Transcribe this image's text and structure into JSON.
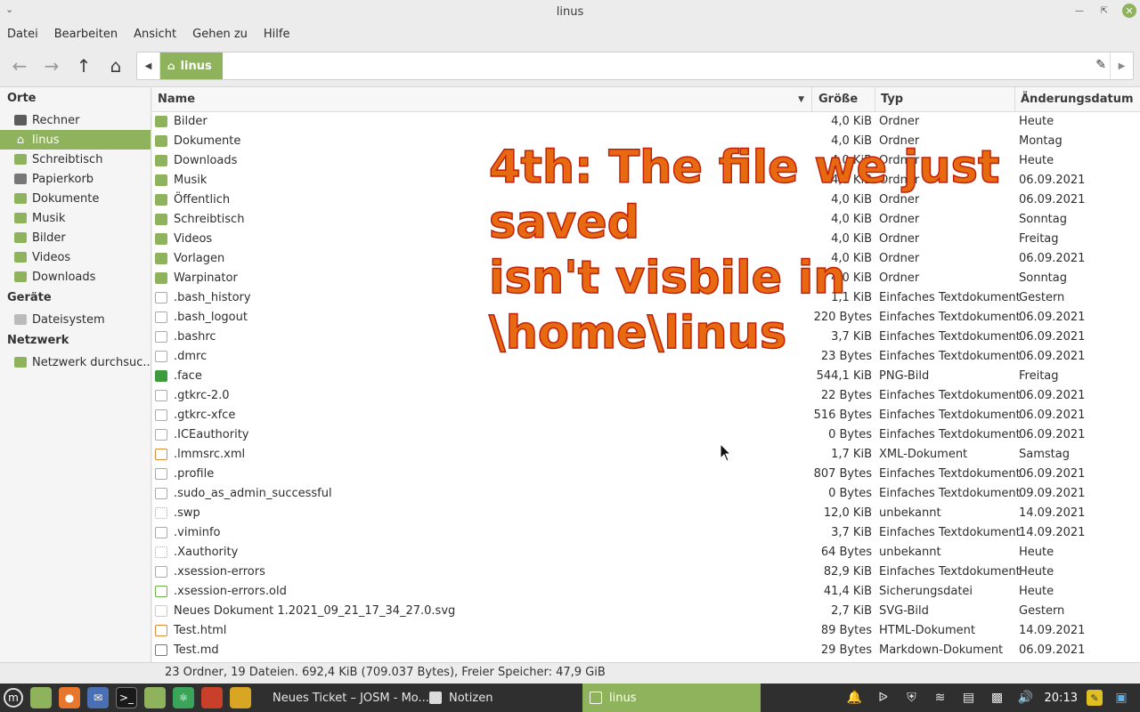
{
  "window": {
    "title": "linus"
  },
  "menu": [
    "Datei",
    "Bearbeiten",
    "Ansicht",
    "Gehen zu",
    "Hilfe"
  ],
  "path": {
    "crumb": "linus"
  },
  "sidebar": {
    "sections": [
      {
        "heading": "Orte",
        "items": [
          {
            "label": "Rechner",
            "icon": "computer-icon"
          },
          {
            "label": "linus",
            "icon": "home-icon",
            "active": true
          },
          {
            "label": "Schreibtisch",
            "icon": "desktop-folder-icon"
          },
          {
            "label": "Papierkorb",
            "icon": "trash-icon"
          },
          {
            "label": "Dokumente",
            "icon": "documents-folder-icon"
          },
          {
            "label": "Musik",
            "icon": "music-folder-icon"
          },
          {
            "label": "Bilder",
            "icon": "pictures-folder-icon"
          },
          {
            "label": "Videos",
            "icon": "videos-folder-icon"
          },
          {
            "label": "Downloads",
            "icon": "downloads-folder-icon"
          }
        ]
      },
      {
        "heading": "Geräte",
        "items": [
          {
            "label": "Dateisystem",
            "icon": "drive-icon"
          }
        ]
      },
      {
        "heading": "Netzwerk",
        "items": [
          {
            "label": "Netzwerk durchsuc...",
            "icon": "network-icon"
          }
        ]
      }
    ]
  },
  "columns": {
    "name": "Name",
    "size": "Größe",
    "type": "Typ",
    "date": "Änderungsdatum"
  },
  "files": [
    {
      "name": "Bilder",
      "size": "4,0 KiB",
      "type": "Ordner",
      "date": "Heute",
      "icon": "folder"
    },
    {
      "name": "Dokumente",
      "size": "4,0 KiB",
      "type": "Ordner",
      "date": "Montag",
      "icon": "folder"
    },
    {
      "name": "Downloads",
      "size": "4,0 KiB",
      "type": "Ordner",
      "date": "Heute",
      "icon": "folder"
    },
    {
      "name": "Musik",
      "size": "4,0 KiB",
      "type": "Ordner",
      "date": "06.09.2021",
      "icon": "folder"
    },
    {
      "name": "Öffentlich",
      "size": "4,0 KiB",
      "type": "Ordner",
      "date": "06.09.2021",
      "icon": "folder"
    },
    {
      "name": "Schreibtisch",
      "size": "4,0 KiB",
      "type": "Ordner",
      "date": "Sonntag",
      "icon": "folder"
    },
    {
      "name": "Videos",
      "size": "4,0 KiB",
      "type": "Ordner",
      "date": "Freitag",
      "icon": "folder"
    },
    {
      "name": "Vorlagen",
      "size": "4,0 KiB",
      "type": "Ordner",
      "date": "06.09.2021",
      "icon": "folder"
    },
    {
      "name": "Warpinator",
      "size": "4,0 KiB",
      "type": "Ordner",
      "date": "Sonntag",
      "icon": "folder"
    },
    {
      "name": ".bash_history",
      "size": "1,1 KiB",
      "type": "Einfaches Textdokument",
      "date": "Gestern",
      "icon": "doc"
    },
    {
      "name": ".bash_logout",
      "size": "220 Bytes",
      "type": "Einfaches Textdokument",
      "date": "06.09.2021",
      "icon": "doc"
    },
    {
      "name": ".bashrc",
      "size": "3,7 KiB",
      "type": "Einfaches Textdokument",
      "date": "06.09.2021",
      "icon": "doc"
    },
    {
      "name": ".dmrc",
      "size": "23 Bytes",
      "type": "Einfaches Textdokument",
      "date": "06.09.2021",
      "icon": "doc"
    },
    {
      "name": ".face",
      "size": "544,1 KiB",
      "type": "PNG-Bild",
      "date": "Freitag",
      "icon": "png"
    },
    {
      "name": ".gtkrc-2.0",
      "size": "22 Bytes",
      "type": "Einfaches Textdokument",
      "date": "06.09.2021",
      "icon": "doc"
    },
    {
      "name": ".gtkrc-xfce",
      "size": "516 Bytes",
      "type": "Einfaches Textdokument",
      "date": "06.09.2021",
      "icon": "doc"
    },
    {
      "name": ".ICEauthority",
      "size": "0 Bytes",
      "type": "Einfaches Textdokument",
      "date": "06.09.2021",
      "icon": "doc"
    },
    {
      "name": ".lmmsrc.xml",
      "size": "1,7 KiB",
      "type": "XML-Dokument",
      "date": "Samstag",
      "icon": "xml"
    },
    {
      "name": ".profile",
      "size": "807 Bytes",
      "type": "Einfaches Textdokument",
      "date": "06.09.2021",
      "icon": "doc"
    },
    {
      "name": ".sudo_as_admin_successful",
      "size": "0 Bytes",
      "type": "Einfaches Textdokument",
      "date": "09.09.2021",
      "icon": "doc"
    },
    {
      "name": ".swp",
      "size": "12,0 KiB",
      "type": "unbekannt",
      "date": "14.09.2021",
      "icon": "unknown"
    },
    {
      "name": ".viminfo",
      "size": "3,7 KiB",
      "type": "Einfaches Textdokument",
      "date": "14.09.2021",
      "icon": "doc"
    },
    {
      "name": ".Xauthority",
      "size": "64 Bytes",
      "type": "unbekannt",
      "date": "Heute",
      "icon": "unknown"
    },
    {
      "name": ".xsession-errors",
      "size": "82,9 KiB",
      "type": "Einfaches Textdokument",
      "date": "Heute",
      "icon": "doc"
    },
    {
      "name": ".xsession-errors.old",
      "size": "41,4 KiB",
      "type": "Sicherungsdatei",
      "date": "Heute",
      "icon": "backup"
    },
    {
      "name": "Neues Dokument 1.2021_09_21_17_34_27.0.svg",
      "size": "2,7 KiB",
      "type": "SVG-Bild",
      "date": "Gestern",
      "icon": "svg"
    },
    {
      "name": "Test.html",
      "size": "89 Bytes",
      "type": "HTML-Dokument",
      "date": "14.09.2021",
      "icon": "xml"
    },
    {
      "name": "Test.md",
      "size": "29 Bytes",
      "type": "Markdown-Dokument",
      "date": "06.09.2021",
      "icon": "md"
    }
  ],
  "annotation": {
    "lines": [
      "4th: The file we just saved",
      "isn't visbile in",
      "\\home\\linus"
    ],
    "color": "#e86a10"
  },
  "status": "23 Ordner, 19 Dateien. 692,4 KiB (709.037 Bytes), Freier Speicher: 47,9 GiB",
  "taskbar": {
    "tasks": [
      {
        "label": "Neues Ticket – JOSM - Mo...",
        "icon": "browser-icon",
        "active": false
      },
      {
        "label": "Notizen",
        "icon": "notes-icon",
        "active": false
      },
      {
        "label": "linus",
        "icon": "folder-icon",
        "active": true
      }
    ],
    "clock": "20:13"
  },
  "colors": {
    "accent": "#8fb25c"
  }
}
